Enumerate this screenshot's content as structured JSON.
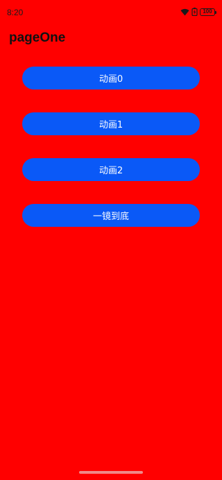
{
  "status_bar": {
    "time": "8:20",
    "battery": "100",
    "icons": [
      "wifi-icon",
      "battery-saver-icon",
      "battery-icon"
    ]
  },
  "page": {
    "title": "pageOne",
    "background_color": "#ff0000"
  },
  "buttons": [
    {
      "label": "动画0"
    },
    {
      "label": "动画1"
    },
    {
      "label": "动画2"
    },
    {
      "label": "一镜到底"
    }
  ],
  "accent_color": "#0a59f7"
}
